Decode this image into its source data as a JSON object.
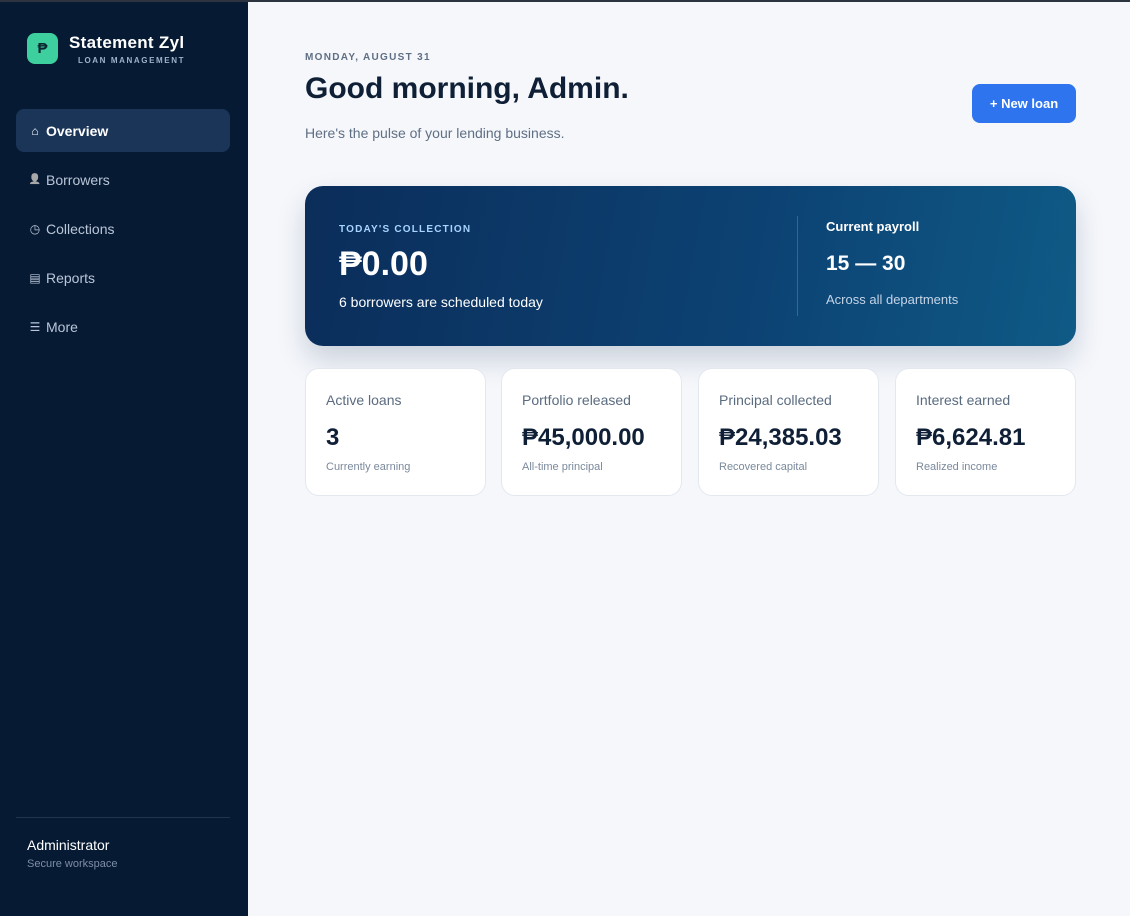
{
  "brand": {
    "logo_glyph": "₱",
    "name": "Statement Zyl",
    "subtitle": "LOAN MANAGEMENT"
  },
  "sidebar": {
    "items": [
      {
        "icon": "⌂",
        "icon_name": "home-icon",
        "label": "Overview",
        "active": true
      },
      {
        "icon": "👤",
        "icon_name": "person-icon",
        "label": "Borrowers",
        "active": false
      },
      {
        "icon": "◷",
        "icon_name": "clock-icon",
        "label": "Collections",
        "active": false
      },
      {
        "icon": "▤",
        "icon_name": "report-icon",
        "label": "Reports",
        "active": false
      },
      {
        "icon": "☰",
        "icon_name": "menu-icon",
        "label": "More",
        "active": false
      }
    ],
    "user": {
      "name": "Administrator",
      "subtitle": "Secure workspace"
    }
  },
  "header": {
    "date": "MONDAY, AUGUST 31",
    "greeting": "Good morning, Admin.",
    "subtitle": "Here's the pulse of your lending business.",
    "new_loan_label": "+ New loan"
  },
  "hero": {
    "label": "TODAY'S COLLECTION",
    "amount": "₱0.00",
    "note": "6 borrowers are scheduled today",
    "payroll_label": "Current payroll",
    "payroll_range": "15 — 30",
    "payroll_note": "Across all departments"
  },
  "stats": [
    {
      "label": "Active loans",
      "value": "3",
      "sub": "Currently earning"
    },
    {
      "label": "Portfolio released",
      "value": "₱45,000.00",
      "sub": "All-time principal"
    },
    {
      "label": "Principal collected",
      "value": "₱24,385.03",
      "sub": "Recovered capital"
    },
    {
      "label": "Interest earned",
      "value": "₱6,624.81",
      "sub": "Realized income"
    }
  ],
  "colors": {
    "sidebar_bg": "#071a33",
    "accent": "#2f74ef",
    "brand_green": "#3ecf9e",
    "hero_start": "#0b2d5a",
    "hero_end": "#0f5a86"
  }
}
